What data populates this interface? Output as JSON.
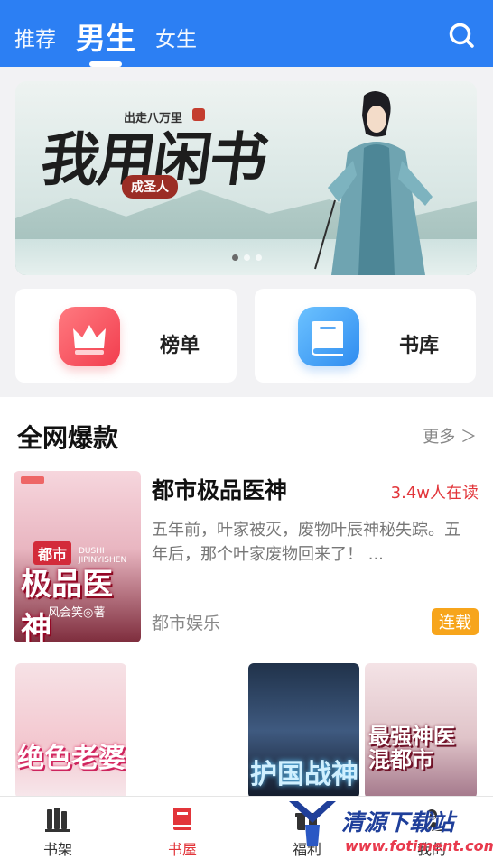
{
  "header": {
    "tabs": [
      "推荐",
      "男生",
      "女生"
    ],
    "active_tab": "男生",
    "search_icon": "search-icon"
  },
  "banner": {
    "author": "出走八万里",
    "title": "我用闲书",
    "tag": "成圣人",
    "dots": 3,
    "active_dot": 0
  },
  "entries": [
    {
      "label": "榜单",
      "icon": "crown-icon",
      "color": "#f23d4e"
    },
    {
      "label": "书库",
      "icon": "book-icon",
      "color": "#2f8cf0"
    }
  ],
  "section": {
    "title": "全网爆款",
    "more": "更多 ＞",
    "featured": {
      "name": "都市极品医神",
      "reading": "3.4w人在读",
      "desc": "五年前，叶家被灭，废物叶辰神秘失踪。五年后，那个叶家废物回来了！ ...",
      "genre": "都市娱乐",
      "status": "连载",
      "cover": {
        "city": "都市",
        "pinyin": "DUSHI JIPINYISHEN",
        "title": "极品医神",
        "author": "风会笑◎著"
      }
    },
    "related": [
      {
        "title": "绝色老婆"
      },
      {
        "title": "护国战神"
      },
      {
        "title": "最强神医混都市"
      }
    ]
  },
  "bottom_nav": [
    {
      "label": "书架",
      "icon": "bookshelf-icon"
    },
    {
      "label": "书屋",
      "icon": "bookstore-icon",
      "active": true
    },
    {
      "label": "福利",
      "icon": "gift-icon"
    },
    {
      "label": "我的",
      "icon": "user-icon"
    }
  ],
  "watermark": {
    "text": "清源下载站",
    "url": "www.fotiment.com"
  },
  "colors": {
    "primary": "#2c7ff3",
    "accent_red": "#e2353a",
    "status_orange": "#f7a51c"
  }
}
